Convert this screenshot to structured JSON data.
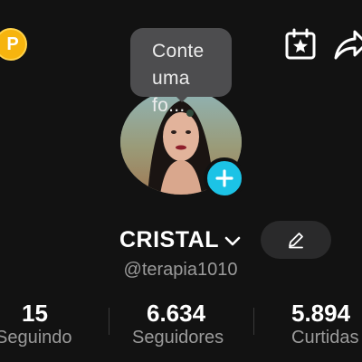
{
  "coin": {
    "glyph": "P",
    "color": "#f6b40e"
  },
  "bubble": {
    "line1": "Conte",
    "line2": "uma fo..."
  },
  "profile": {
    "name": "CRISTAL",
    "handle": "@terapia1010"
  },
  "stats": [
    {
      "value": "15",
      "label": "Seguindo"
    },
    {
      "value": "6.634",
      "label": "Seguidores"
    },
    {
      "value": "5.894",
      "label": "Curtidas"
    }
  ],
  "icons": {
    "favorites": "favorites-calendar-star-icon",
    "share": "share-arrow-icon",
    "add": "plus-icon",
    "edit": "pencil-icon",
    "dropdown": "chevron-down-icon"
  },
  "colors": {
    "background": "#121212",
    "accent": "#1cc3e6",
    "muted": "#9a9a9a"
  }
}
